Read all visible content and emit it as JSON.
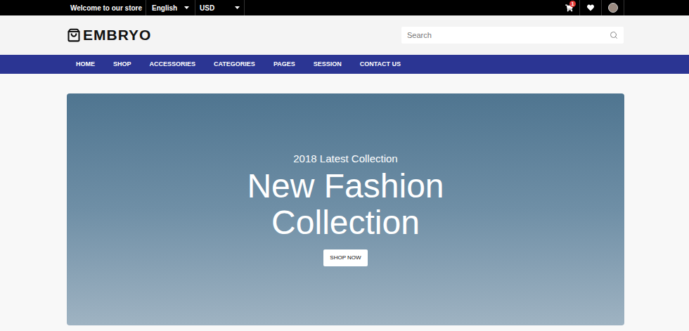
{
  "topbar": {
    "welcome": "Welcome to our store",
    "language": "English",
    "currency": "USD",
    "cart_count": "1"
  },
  "logo": "EMBRYO",
  "search": {
    "placeholder": "Search"
  },
  "nav": [
    {
      "label": "HOME"
    },
    {
      "label": "SHOP"
    },
    {
      "label": "ACCESSORIES"
    },
    {
      "label": "CATEGORIES"
    },
    {
      "label": "PAGES"
    },
    {
      "label": "SESSION"
    },
    {
      "label": "CONTACT US"
    }
  ],
  "hero": {
    "subtitle": "2018 Latest Collection",
    "title_lines": [
      "New Fashion",
      "Collection"
    ],
    "button": "SHOP NOW"
  }
}
